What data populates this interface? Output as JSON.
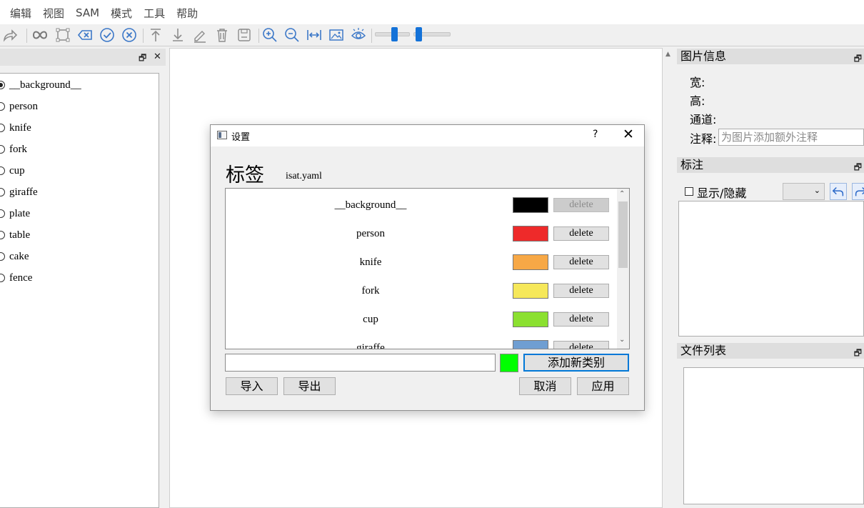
{
  "menubar": {
    "items": [
      "编辑",
      "视图",
      "SAM",
      "模式",
      "工具",
      "帮助"
    ]
  },
  "toolbar": {
    "icons": [
      "redo-icon",
      "infinity-icon",
      "polygon-icon",
      "backspace-icon",
      "check-circle-icon",
      "cancel-circle-icon",
      "move-top-icon",
      "move-bottom-icon",
      "edit-icon",
      "delete-icon",
      "save-icon",
      "zoom-in-icon",
      "zoom-out-icon",
      "fit-width-icon",
      "image-icon",
      "eye-icon"
    ]
  },
  "left_panel": {
    "labels": [
      "__background__",
      "person",
      "knife",
      "fork",
      "cup",
      "giraffe",
      "plate",
      "table",
      "cake",
      "fence"
    ],
    "selected": "__background__",
    "float_symbol": "🗗",
    "close_symbol": "✕"
  },
  "right_panel": {
    "image_info_title": "图片信息",
    "width_label": "宽:",
    "height_label": "高:",
    "channel_label": "通道:",
    "note_label": "注释:",
    "note_placeholder": "为图片添加额外注释",
    "annotation_title": "标注",
    "show_hide_label": "显示/隐藏",
    "file_list_title": "文件列表",
    "float_symbol": "🗗"
  },
  "dialog": {
    "title": "设置",
    "help": "?",
    "close": "✕",
    "heading": "标签",
    "file": "isat.yaml",
    "labels": [
      {
        "name": "__background__",
        "color": "#000000",
        "delete": "delete",
        "disabled": true
      },
      {
        "name": "person",
        "color": "#ee2a2a",
        "delete": "delete",
        "disabled": false
      },
      {
        "name": "knife",
        "color": "#f7a846",
        "delete": "delete",
        "disabled": false
      },
      {
        "name": "fork",
        "color": "#f6e85a",
        "delete": "delete",
        "disabled": false
      },
      {
        "name": "cup",
        "color": "#8be030",
        "delete": "delete",
        "disabled": false
      },
      {
        "name": "giraffe",
        "color": "#6f9ed2",
        "delete": "delete",
        "disabled": false
      }
    ],
    "new_label_value": "",
    "new_label_color": "#00ff00",
    "add_button": "添加新类别",
    "import_button": "导入",
    "export_button": "导出",
    "cancel_button": "取消",
    "apply_button": "应用"
  }
}
